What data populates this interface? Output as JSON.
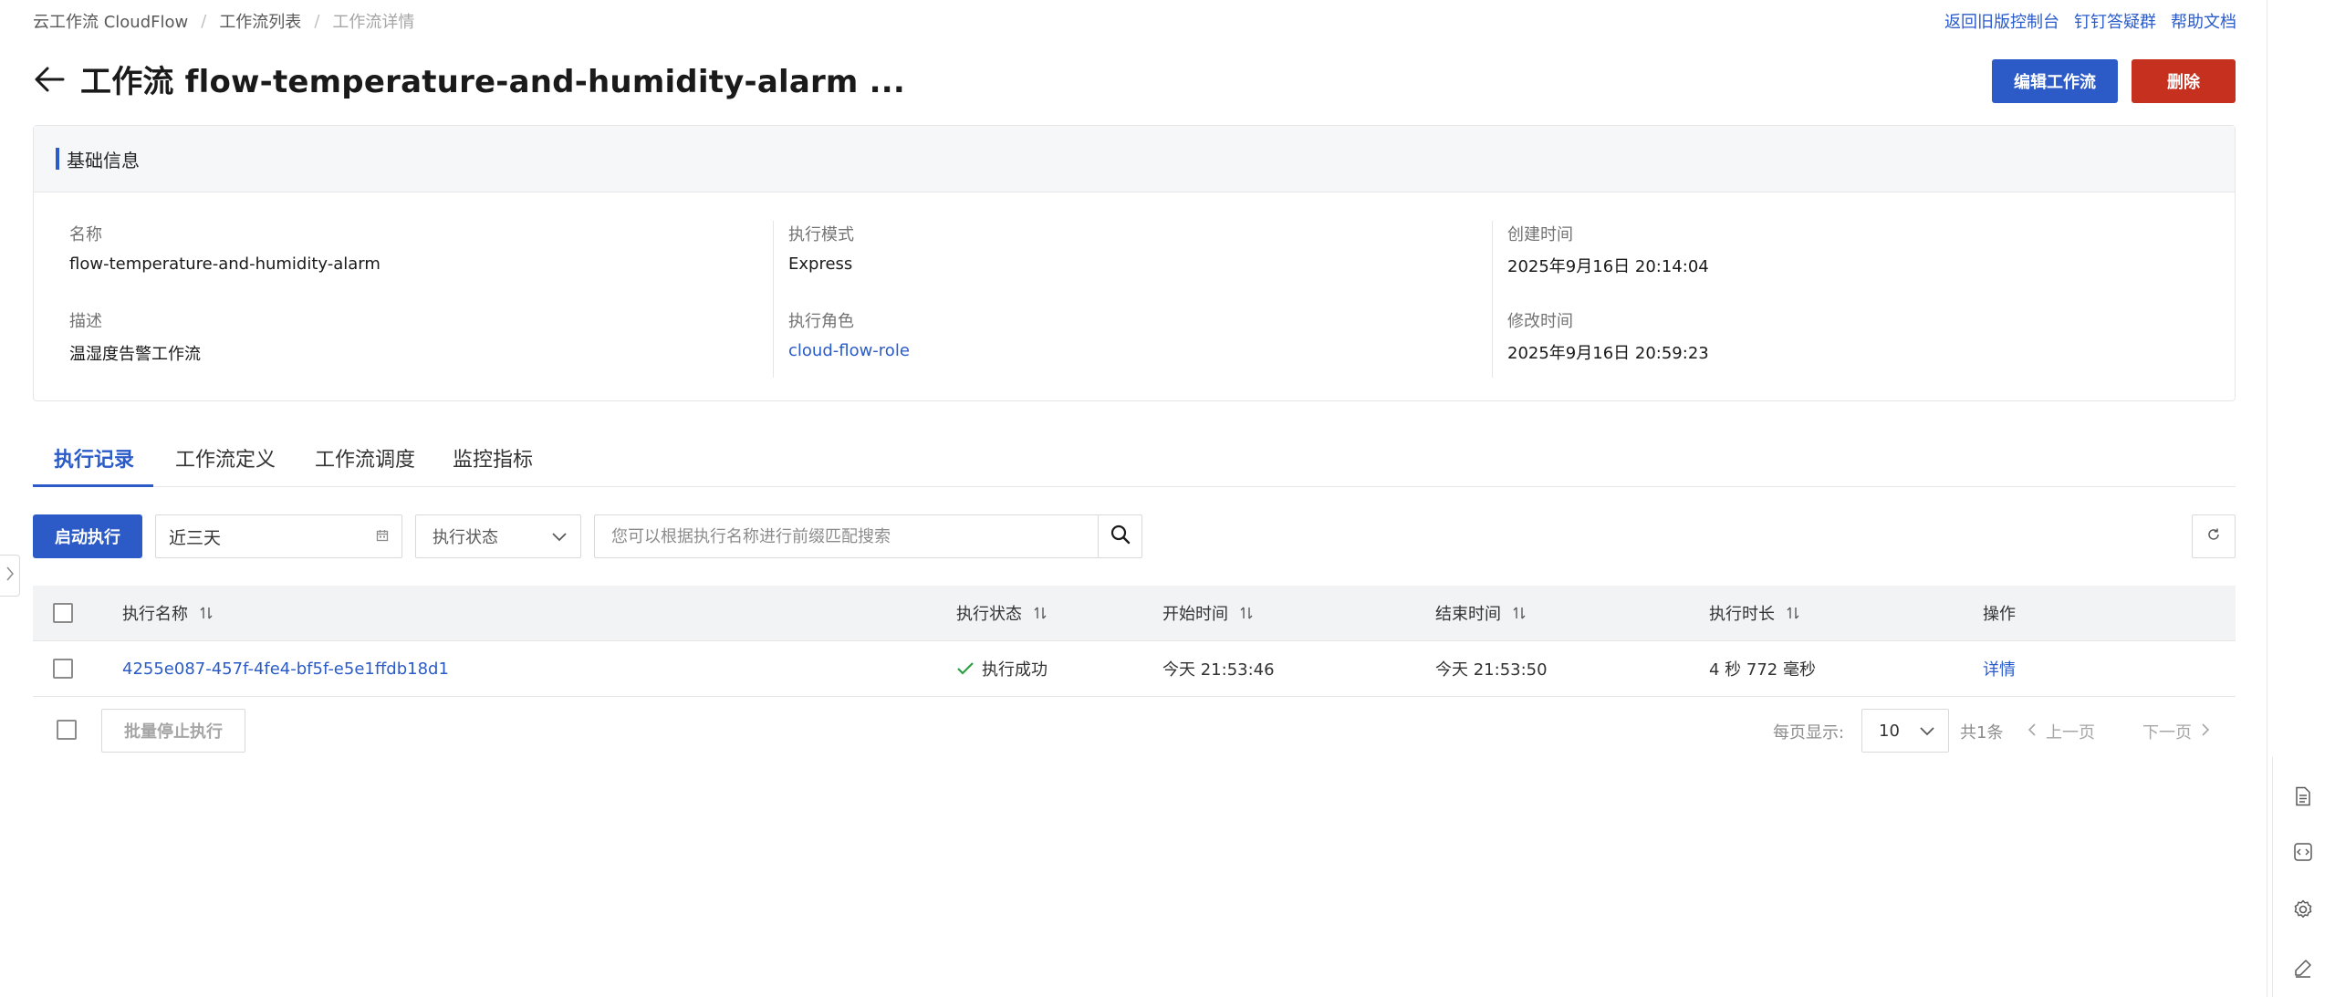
{
  "breadcrumb": {
    "items": [
      "云工作流 CloudFlow",
      "工作流列表",
      "工作流详情"
    ]
  },
  "top_links": [
    "返回旧版控制台",
    "钉钉答疑群",
    "帮助文档"
  ],
  "header": {
    "title": "工作流 flow-temperature-and-humidity-alarm ...",
    "edit_label": "编辑工作流",
    "delete_label": "删除"
  },
  "basic_info": {
    "title": "基础信息",
    "name_label": "名称",
    "name_value": "flow-temperature-and-humidity-alarm",
    "desc_label": "描述",
    "desc_value": "温湿度告警工作流",
    "mode_label": "执行模式",
    "mode_value": "Express",
    "role_label": "执行角色",
    "role_value": "cloud-flow-role",
    "created_label": "创建时间",
    "created_value": "2025年9月16日 20:14:04",
    "modified_label": "修改时间",
    "modified_value": "2025年9月16日 20:59:23"
  },
  "tabs": [
    "执行记录",
    "工作流定义",
    "工作流调度",
    "监控指标"
  ],
  "toolbar": {
    "start_label": "启动执行",
    "date_range": "近三天",
    "status_placeholder": "执行状态",
    "search_placeholder": "您可以根据执行名称进行前缀匹配搜索"
  },
  "table": {
    "headers": [
      "执行名称",
      "执行状态",
      "开始时间",
      "结束时间",
      "执行时长",
      "操作"
    ],
    "rows": [
      {
        "name": "4255e087-457f-4fe4-bf5f-e5e1ffdb18d1",
        "status": "执行成功",
        "start": "今天 21:53:46",
        "end": "今天 21:53:50",
        "duration": "4 秒 772 毫秒",
        "action": "详情"
      }
    ]
  },
  "footer": {
    "batch_stop_label": "批量停止执行",
    "page_size_label": "每页显示:",
    "page_size": "10",
    "total": "共1条",
    "prev": "上一页",
    "next": "下一页"
  },
  "colors": {
    "primary": "#2c5bc7",
    "danger": "#c6301f",
    "success": "#2e9e44"
  }
}
